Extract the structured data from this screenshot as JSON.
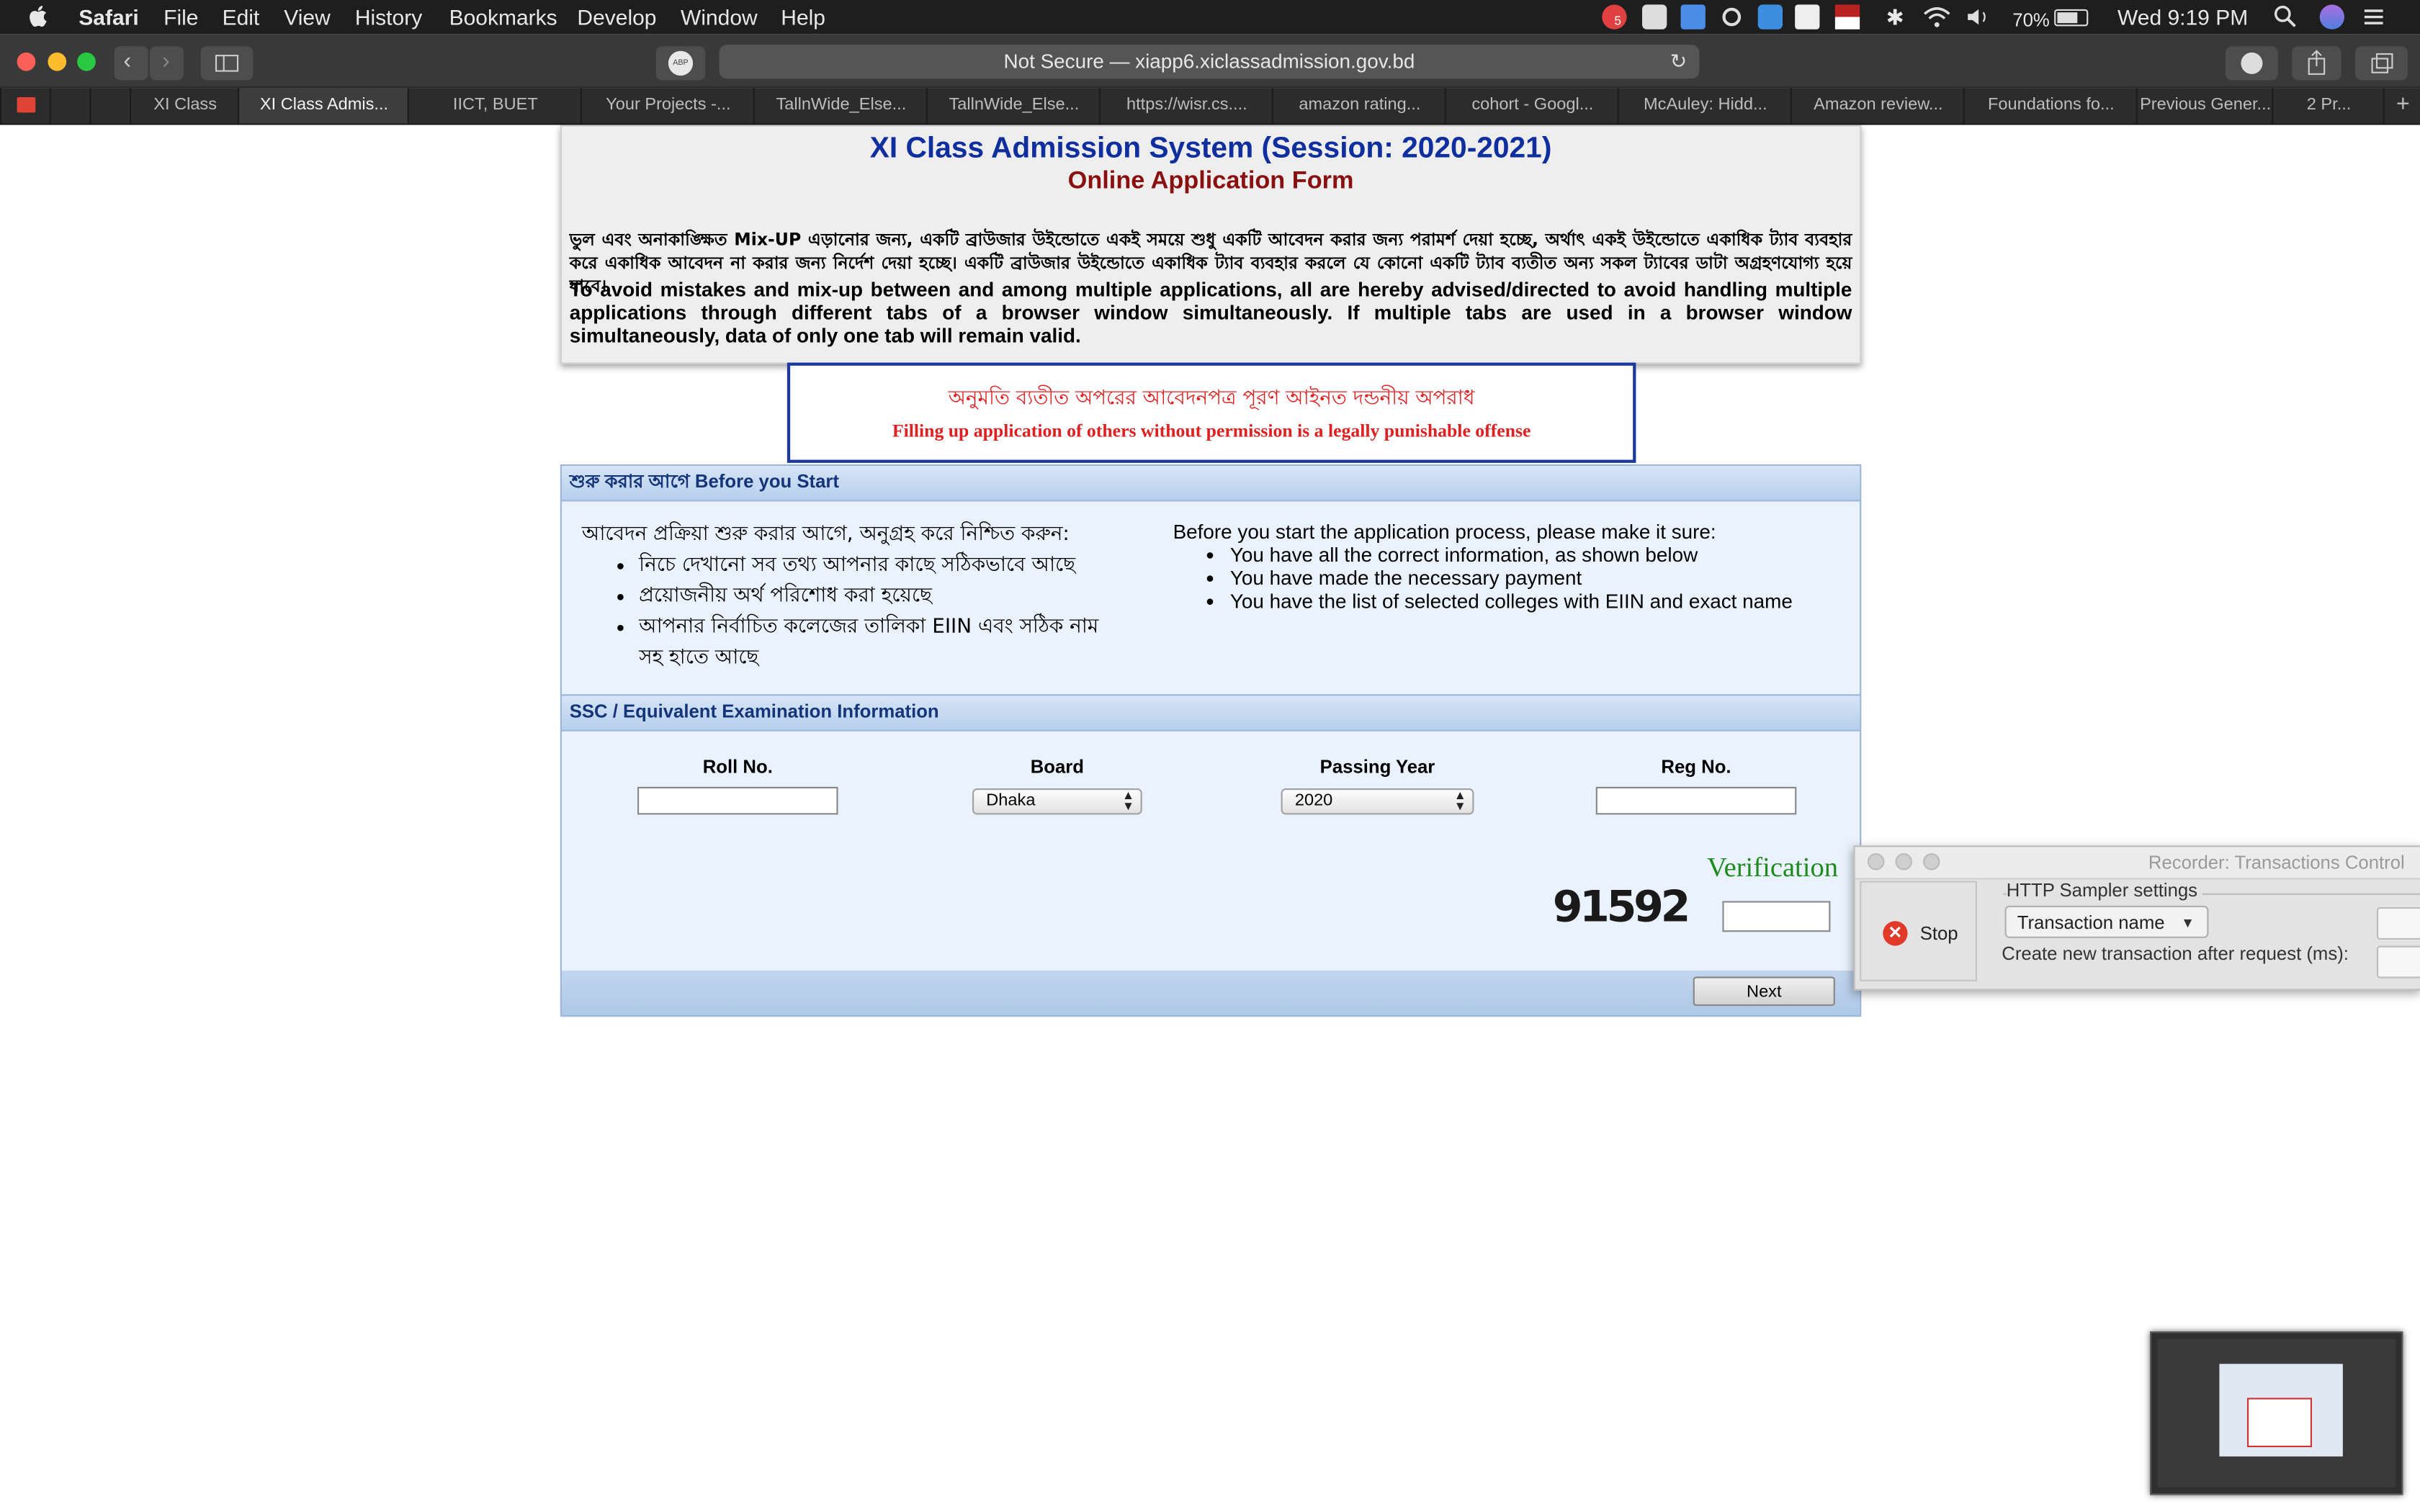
{
  "menubar": {
    "app": "Safari",
    "items": [
      "File",
      "Edit",
      "View",
      "History",
      "Bookmarks",
      "Develop",
      "Window",
      "Help"
    ],
    "battery": "70%",
    "clock": "Wed 9:19 PM",
    "badge": "5"
  },
  "toolbar": {
    "abp_label": "ABP",
    "url": "Not Secure — xiapp6.xiclassadmission.gov.bd"
  },
  "tabs": [
    {
      "label": "XI Class",
      "active": false
    },
    {
      "label": "XI Class Admis...",
      "active": true
    },
    {
      "label": "IICT, BUET",
      "active": false
    },
    {
      "label": "Your Projects -...",
      "active": false
    },
    {
      "label": "TallnWide_Else...",
      "active": false
    },
    {
      "label": "TallnWide_Else...",
      "active": false
    },
    {
      "label": "https://wisr.cs....",
      "active": false
    },
    {
      "label": "amazon rating...",
      "active": false
    },
    {
      "label": "cohort - Googl...",
      "active": false
    },
    {
      "label": "McAuley: Hidd...",
      "active": false
    },
    {
      "label": "Amazon review...",
      "active": false
    },
    {
      "label": "Foundations fo...",
      "active": false
    },
    {
      "label": "Previous Gener...",
      "active": false
    },
    {
      "label": "2 Pr...",
      "active": false
    }
  ],
  "page": {
    "title": "XI Class Admission System (Session: 2020-2021)",
    "subtitle": "Online Application Form",
    "bn_warning": "ভুল এবং অনাকাঙ্ক্ষিত Mix-UP এড়ানোর জন্য, একটি ব্রাউজার উইন্ডোতে একই সময়ে শুধু একটি আবেদন করার জন্য পরামর্শ দেয়া হচ্ছে, অর্থাৎ একই উইন্ডোতে একাধিক ট্যাব ব্যবহার করে একাধিক আবেদন না করার জন্য নির্দেশ দেয়া হচ্ছে। একটি ব্রাউজার উইন্ডোতে একাধিক ট্যাব ব্যবহার করলে যে কোনো একটি ট্যাব ব্যতীত অন্য সকল ট্যাবের ডাটা অগ্রহণযোগ্য হয়ে যাবে।",
    "en_warning": "To avoid mistakes and mix-up between and among multiple applications, all are hereby advised/directed to avoid handling multiple applications through different tabs of a browser window simultaneously. If multiple tabs are used in a browser window simultaneously, data of only one tab will remain valid.",
    "legal_bn": "অনুমতি ব্যতীত অপরের আবেদনপত্র পূরণ আইনত দন্ডনীয় অপরাধ",
    "legal_en": "Filling up application of others without permission is a legally punishable offense",
    "before_start": {
      "heading": "শুরু করার আগে Before you Start",
      "bn_intro": "আবেদন প্রক্রিয়া শুরু করার আগে, অনুগ্রহ করে নিশ্চিত করুন:",
      "bn_items": [
        "নিচে দেখানো সব তথ্য আপনার কাছে সঠিকভাবে আছে",
        "প্রয়োজনীয় অর্থ পরিশোধ করা হয়েছে",
        "আপনার নির্বাচিত কলেজের তালিকা EIIN এবং সঠিক নাম সহ হাতে আছে"
      ],
      "en_intro": "Before you start the application process, please make it sure:",
      "en_items": [
        "You have all the correct information, as shown below",
        "You have made the necessary payment",
        "You have the list of selected colleges with EIIN and exact name"
      ]
    },
    "ssc": {
      "heading": "SSC / Equivalent Examination Information",
      "roll_label": "Roll No.",
      "board_label": "Board",
      "board_value": "Dhaka",
      "year_label": "Passing Year",
      "year_value": "2020",
      "reg_label": "Reg No.",
      "verification_label": "Verification",
      "captcha": "91592",
      "next_label": "Next"
    }
  },
  "recorder": {
    "title": "Recorder: Transactions Control",
    "stop_label": "Stop",
    "http_label": "HTTP Sampler settings",
    "transaction_value": "Transaction name",
    "create_label": "Create new transaction after request (ms):"
  }
}
